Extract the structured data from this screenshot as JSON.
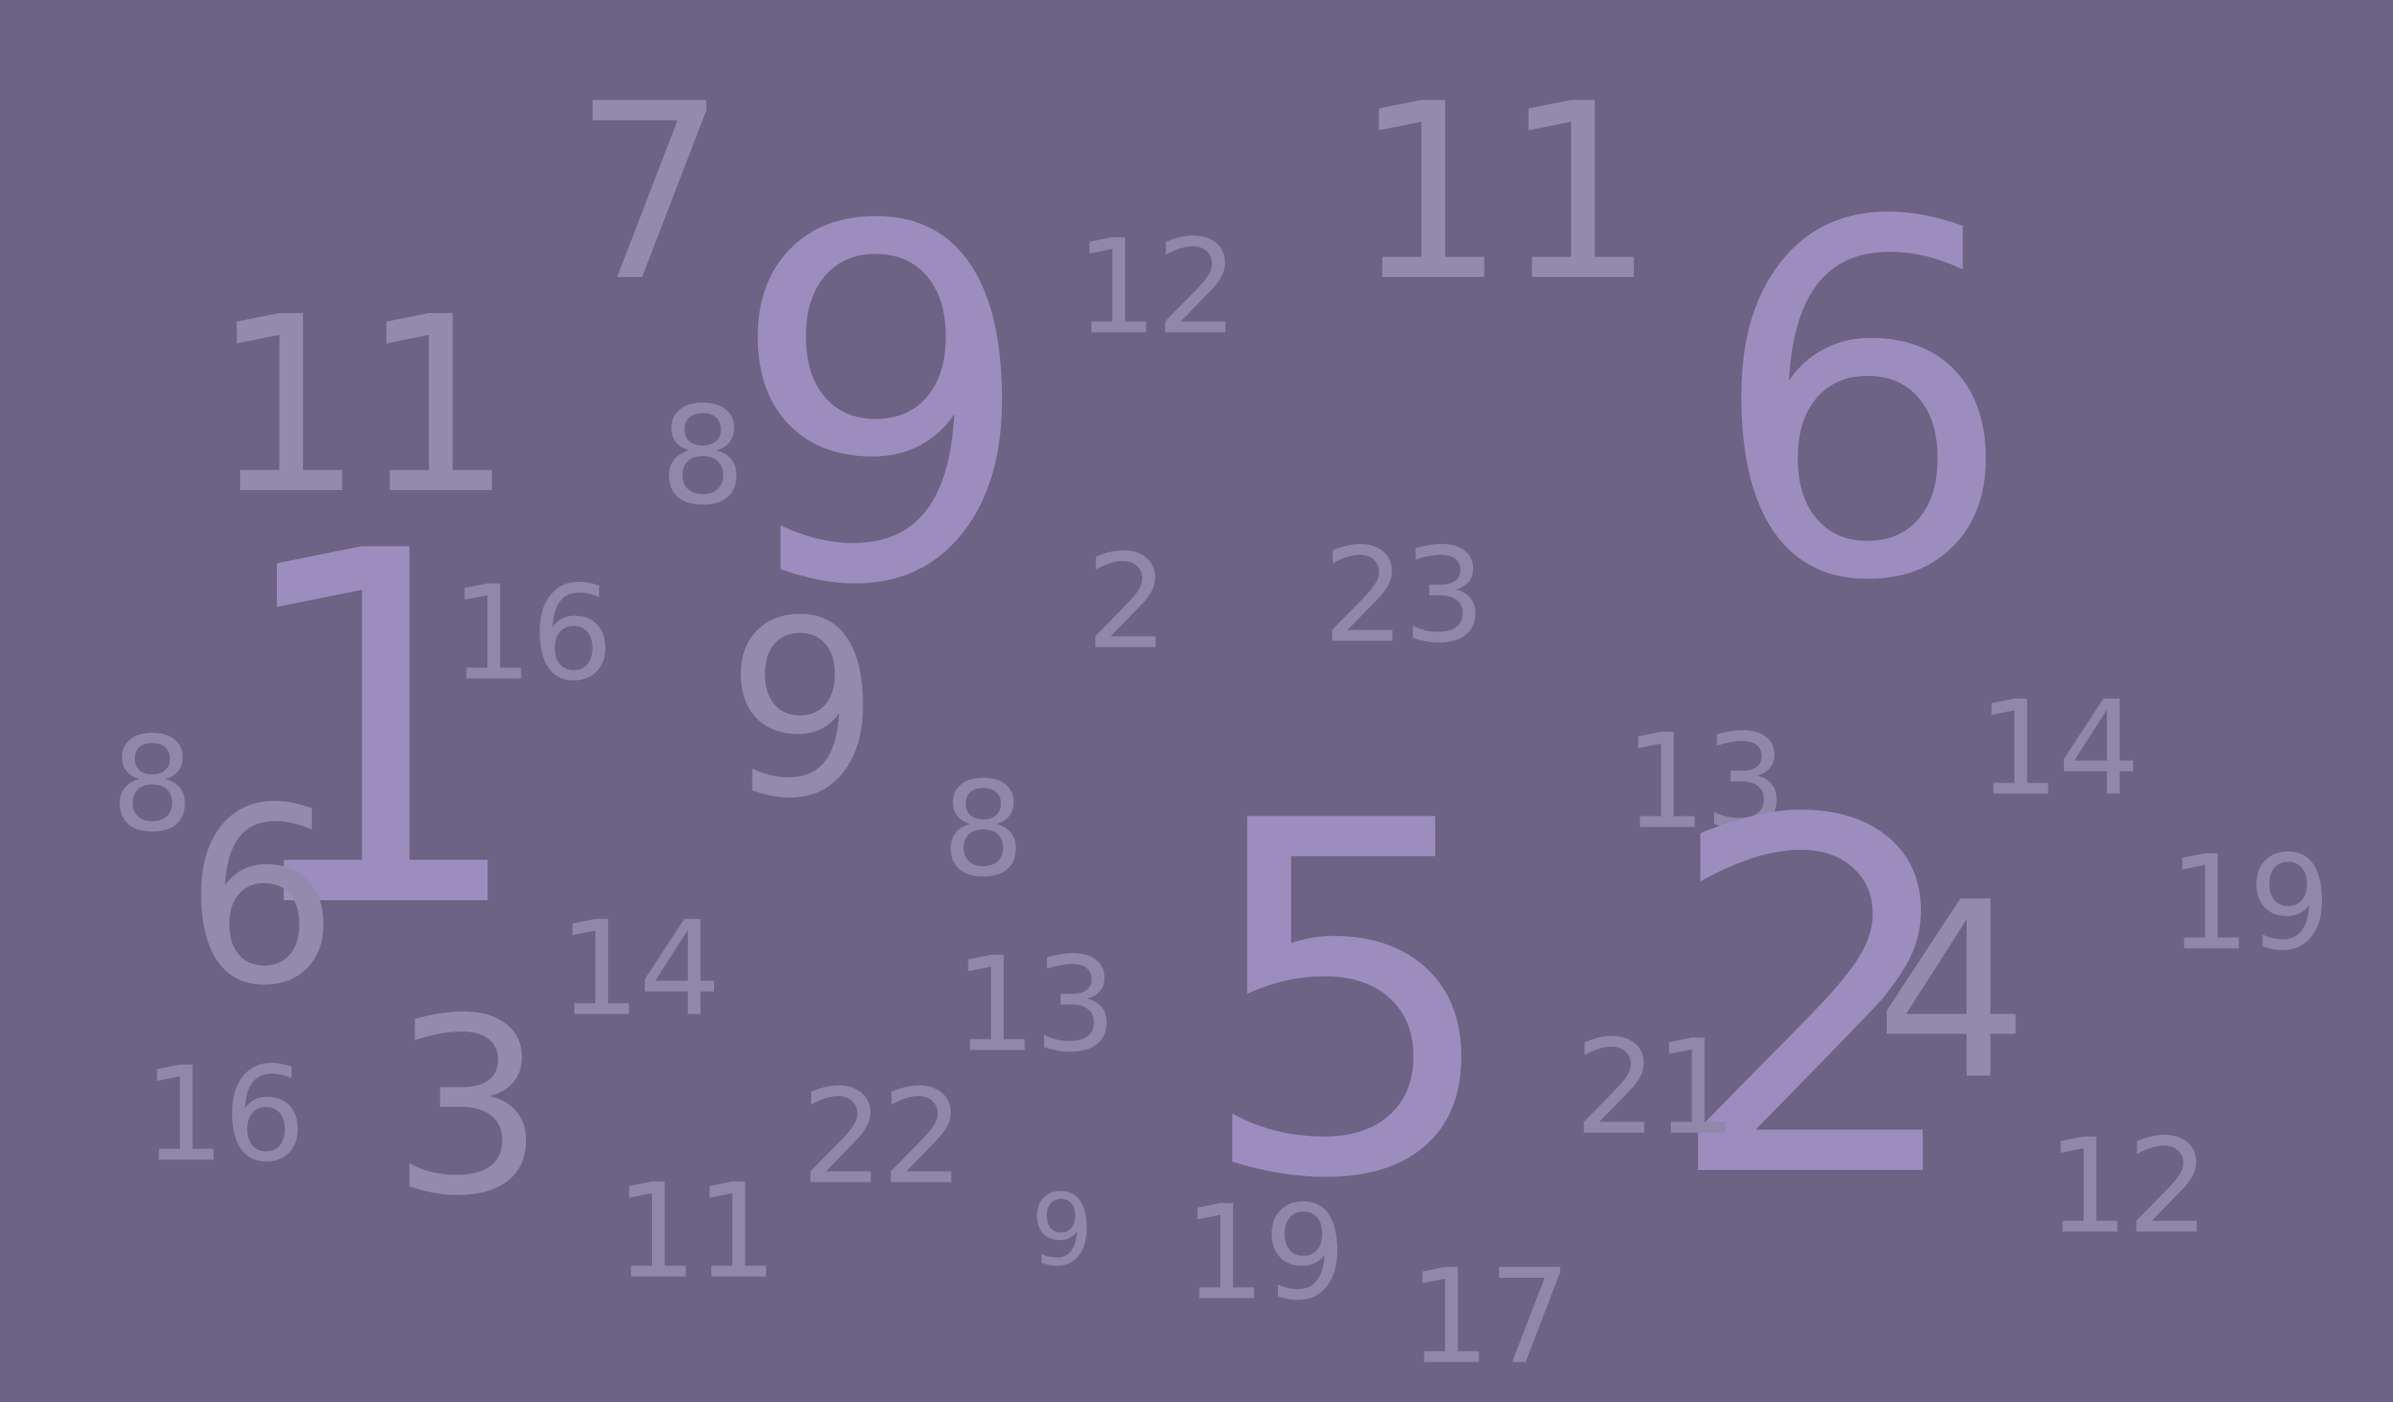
{
  "board": {
    "background": "#6c6385",
    "number_color_large": "#9b8ebf",
    "number_color_small": "#9088aa",
    "numbers": [
      {
        "value": "7"
      },
      {
        "value": "11"
      },
      {
        "value": "11"
      },
      {
        "value": "9"
      },
      {
        "value": "12"
      },
      {
        "value": "6"
      },
      {
        "value": "8"
      },
      {
        "value": "1"
      },
      {
        "value": "16"
      },
      {
        "value": "9"
      },
      {
        "value": "2"
      },
      {
        "value": "23"
      },
      {
        "value": "8"
      },
      {
        "value": "6"
      },
      {
        "value": "8"
      },
      {
        "value": "13"
      },
      {
        "value": "14"
      },
      {
        "value": "19"
      },
      {
        "value": "14"
      },
      {
        "value": "13"
      },
      {
        "value": "5"
      },
      {
        "value": "2"
      },
      {
        "value": "4"
      },
      {
        "value": "21"
      },
      {
        "value": "16"
      },
      {
        "value": "3"
      },
      {
        "value": "22"
      },
      {
        "value": "12"
      },
      {
        "value": "11"
      },
      {
        "value": "9"
      },
      {
        "value": "19"
      },
      {
        "value": "17"
      }
    ]
  }
}
